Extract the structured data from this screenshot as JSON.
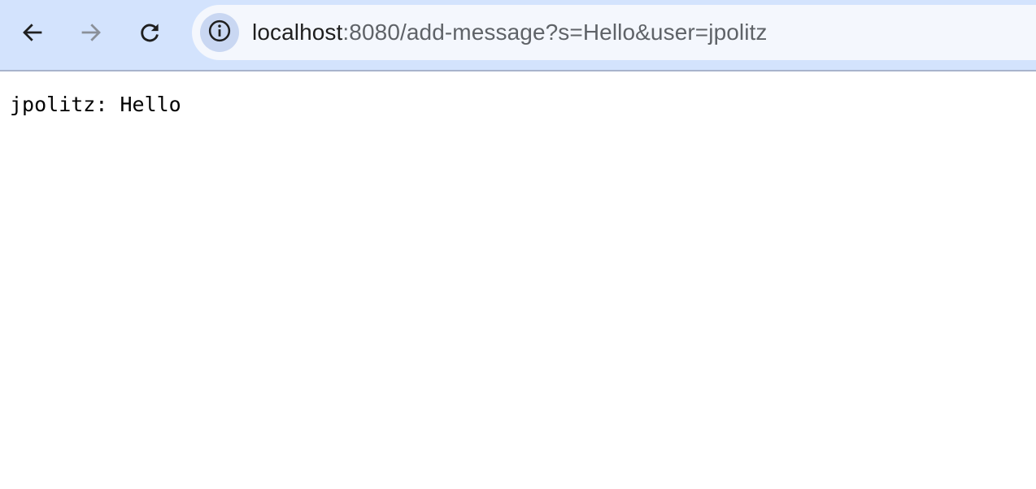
{
  "browser": {
    "url_host": "localhost",
    "url_rest": ":8080/add-message?s=Hello&user=jpolitz",
    "icons": {
      "back": "arrow-left-icon",
      "forward": "arrow-right-icon",
      "reload": "reload-icon",
      "site_info": "info-icon"
    }
  },
  "page": {
    "message": "jpolitz: Hello"
  }
}
